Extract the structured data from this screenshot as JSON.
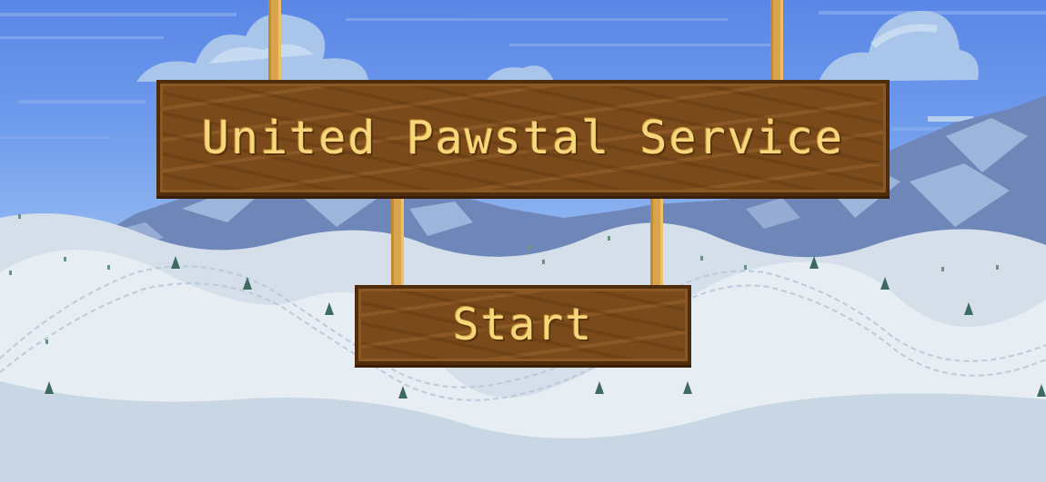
{
  "title": "United Pawstal Service",
  "start_label": "Start",
  "colors": {
    "sky_top": "#5a86e6",
    "sky_bottom": "#8cb4f0",
    "mountain": "#6f86b8",
    "snow": "#dfe8f1",
    "wood": "#7a4a1a",
    "text": "#f6d77c"
  }
}
